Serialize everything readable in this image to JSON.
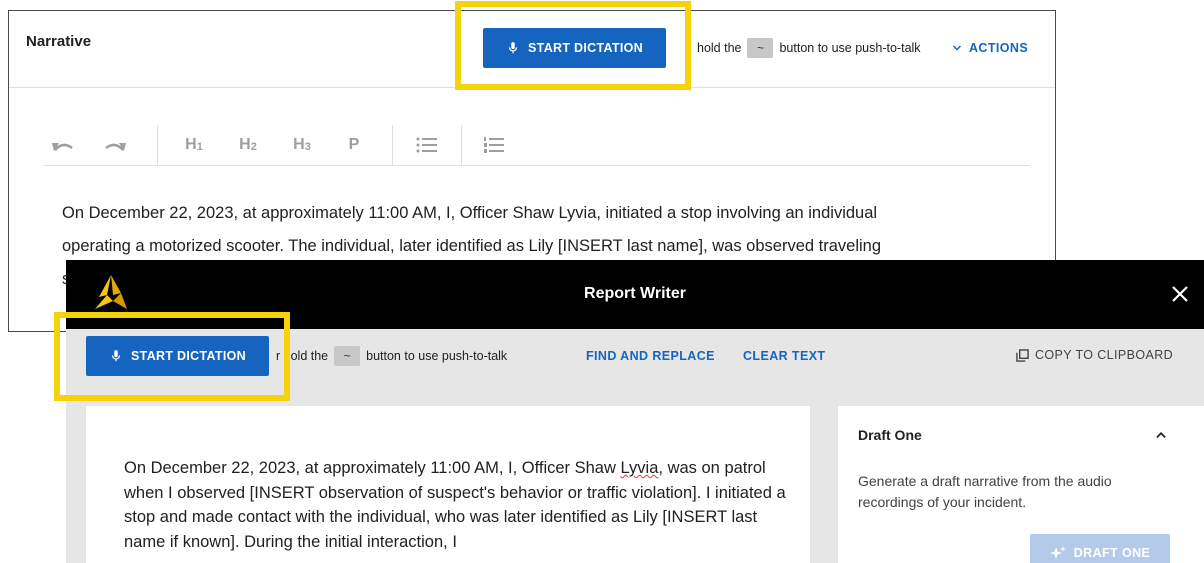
{
  "narrative": {
    "title": "Narrative",
    "dictation_label": "START DICTATION",
    "ptt_prefix": "hold the",
    "ptt_key": "~",
    "ptt_suffix": "button to use push-to-talk",
    "actions_label": "ACTIONS",
    "toolbar": {
      "h1": "H",
      "h1_sub": "1",
      "h2": "H",
      "h2_sub": "2",
      "h3": "H",
      "h3_sub": "3",
      "p": "P"
    },
    "body_lines": [
      "On December 22, 2023, at approximately 11:00 AM, I, Officer Shaw Lyvia, initiated a stop involving an individual",
      "operating a motorized scooter. The individual, later identified as Lily [INSERT last name], was observed traveling",
      "s"
    ]
  },
  "report_writer": {
    "title": "Report Writer",
    "dictation_label": "START DICTATION",
    "ptt_prefix": "r hold the",
    "ptt_key": "~",
    "ptt_suffix": "button to use push-to-talk",
    "find_replace_label": "FIND AND REPLACE",
    "clear_text_label": "CLEAR TEXT",
    "copy_label": "COPY TO CLIPBOARD",
    "editor": {
      "part1": "On December 22, 2023, at approximately 11:00 AM, I, Officer Shaw ",
      "misspelled": "Lyvia",
      "part2": ", was on patrol when I observed [INSERT observation of suspect's behavior or traffic violation]. I initiated a stop and made contact with the individual, who was later identified as Lily [INSERT last name if known]. During the initial interaction, I"
    },
    "draft_one": {
      "title": "Draft One",
      "description": "Generate a draft narrative from the audio recordings of your incident.",
      "button_label": "DRAFT ONE"
    }
  },
  "colors": {
    "primary": "#1565c0",
    "highlight": "#f5d30a",
    "titlebar": "#000000",
    "toolbar_bg": "#e6e6e6",
    "disabled_button": "#b3cbe8"
  },
  "icons": [
    "microphone-icon",
    "chevron-down-icon",
    "undo-icon",
    "redo-icon",
    "bullet-list-icon",
    "numbered-list-icon",
    "logo-icon",
    "close-icon",
    "copy-icon",
    "chevron-up-icon",
    "sparkle-icon"
  ]
}
